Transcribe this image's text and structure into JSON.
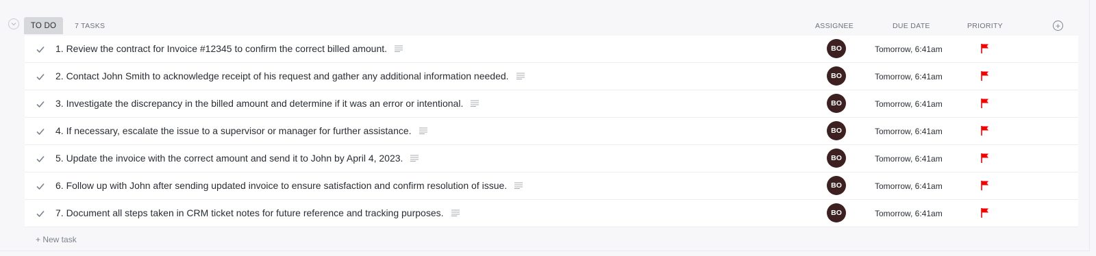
{
  "group": {
    "status_label": "TO DO",
    "task_count": "7 TASKS",
    "status_color": "#d6d8dc"
  },
  "columns": {
    "assignee": "ASSIGNEE",
    "due_date": "DUE DATE",
    "priority": "PRIORITY"
  },
  "tasks": [
    {
      "title": "1. Review the contract for Invoice #12345 to confirm the correct billed amount.",
      "assignee": "BO",
      "due": "Tomorrow, 6:41am",
      "priority_color": "#f50000"
    },
    {
      "title": "2. Contact John Smith to acknowledge receipt of his request and gather any additional information needed.",
      "assignee": "BO",
      "due": "Tomorrow, 6:41am",
      "priority_color": "#f50000"
    },
    {
      "title": "3. Investigate the discrepancy in the billed amount and determine if it was an error or intentional.",
      "assignee": "BO",
      "due": "Tomorrow, 6:41am",
      "priority_color": "#f50000"
    },
    {
      "title": "4. If necessary, escalate the issue to a supervisor or manager for further assistance.",
      "assignee": "BO",
      "due": "Tomorrow, 6:41am",
      "priority_color": "#f50000"
    },
    {
      "title": "5. Update the invoice with the correct amount and send it to John by April 4, 2023.",
      "assignee": "BO",
      "due": "Tomorrow, 6:41am",
      "priority_color": "#f50000"
    },
    {
      "title": "6. Follow up with John after sending updated invoice to ensure satisfaction and confirm resolution of issue.",
      "assignee": "BO",
      "due": "Tomorrow, 6:41am",
      "priority_color": "#f50000"
    },
    {
      "title": "7. Document all steps taken in CRM ticket notes for future reference and tracking purposes.",
      "assignee": "BO",
      "due": "Tomorrow, 6:41am",
      "priority_color": "#f50000"
    }
  ],
  "new_task_label": "+ New task",
  "colors": {
    "avatar_bg": "#3d2020",
    "priority_flag": "#f50000"
  }
}
